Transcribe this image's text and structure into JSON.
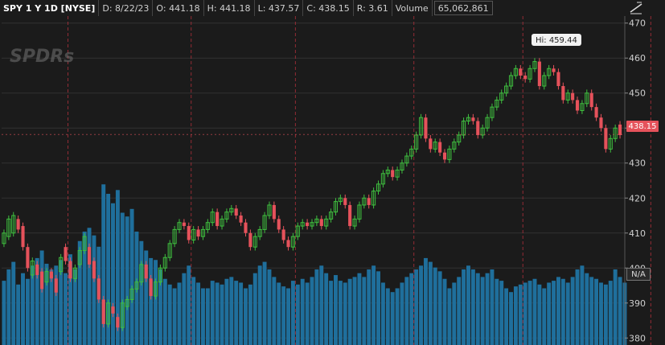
{
  "header": {
    "symbol": "SPY 1 Y 1D [NYSE]",
    "date": "D: 8/22/23",
    "open": "O: 441.18",
    "high": "H: 441.18",
    "low": "L: 437.57",
    "close": "C: 438.15",
    "range": "R: 3.61",
    "volume_label": "Volume",
    "volume_value": "65,062,861"
  },
  "watermark": "SPDRs",
  "hi_callout": "Hi: 459.44",
  "last_price_label": "438.15",
  "volume_badge": "N/A",
  "icons": {
    "draw": "drawing-tools-icon"
  },
  "colors": {
    "up": "#3fbf3f",
    "down": "#e5525b",
    "volume": "#1f6f9c",
    "grid": "#333333",
    "divider": "#b0303b",
    "background": "#1b1b1b"
  },
  "chart_data": {
    "type": "candlestick",
    "xlabel": "",
    "ylabel": "",
    "ylim": [
      378,
      472
    ],
    "yticks": [
      380,
      390,
      400,
      410,
      420,
      430,
      440,
      450,
      460,
      470
    ],
    "grid": true,
    "last_price": 438.15,
    "high": 459.44,
    "month_dividers_index": [
      14,
      40,
      62,
      87,
      110,
      137,
      162
    ],
    "candles": [
      [
        407,
        410
      ],
      [
        409,
        414
      ],
      [
        410,
        415
      ],
      [
        414,
        411
      ],
      [
        412,
        406
      ],
      [
        406,
        400
      ],
      [
        398,
        402
      ],
      [
        401,
        398
      ],
      [
        399,
        394
      ],
      [
        396,
        399
      ],
      [
        399,
        397
      ],
      [
        397,
        393
      ],
      [
        399,
        403
      ],
      [
        406,
        402
      ],
      [
        402,
        397
      ],
      [
        397,
        400
      ],
      [
        401,
        405
      ],
      [
        405,
        409
      ],
      [
        406,
        401
      ],
      [
        402,
        397
      ],
      [
        397,
        391
      ],
      [
        391,
        384
      ],
      [
        384,
        390
      ],
      [
        389,
        387
      ],
      [
        386,
        383
      ],
      [
        383,
        390
      ],
      [
        389,
        391
      ],
      [
        391,
        394
      ],
      [
        394,
        396
      ],
      [
        396,
        401
      ],
      [
        401,
        397
      ],
      [
        397,
        392
      ],
      [
        392,
        396
      ],
      [
        396,
        400
      ],
      [
        400,
        403
      ],
      [
        403,
        407
      ],
      [
        407,
        411
      ],
      [
        411,
        413
      ],
      [
        413,
        412
      ],
      [
        412,
        408
      ],
      [
        408,
        411
      ],
      [
        411,
        409
      ],
      [
        409,
        411
      ],
      [
        411,
        413
      ],
      [
        413,
        416
      ],
      [
        416,
        412
      ],
      [
        412,
        414
      ],
      [
        414,
        416
      ],
      [
        416,
        417
      ],
      [
        417,
        415
      ],
      [
        415,
        413
      ],
      [
        413,
        410
      ],
      [
        410,
        406
      ],
      [
        406,
        409
      ],
      [
        409,
        411
      ],
      [
        411,
        415
      ],
      [
        415,
        418
      ],
      [
        418,
        414
      ],
      [
        414,
        411
      ],
      [
        411,
        408
      ],
      [
        408,
        406
      ],
      [
        406,
        409
      ],
      [
        409,
        412
      ],
      [
        412,
        413
      ],
      [
        413,
        412
      ],
      [
        412,
        413
      ],
      [
        413,
        414
      ],
      [
        414,
        412
      ],
      [
        412,
        414
      ],
      [
        414,
        416
      ],
      [
        416,
        419
      ],
      [
        419,
        420
      ],
      [
        420,
        418
      ],
      [
        418,
        412
      ],
      [
        412,
        414
      ],
      [
        414,
        418
      ],
      [
        418,
        420
      ],
      [
        420,
        418
      ],
      [
        418,
        422
      ],
      [
        422,
        424
      ],
      [
        424,
        427
      ],
      [
        427,
        428
      ],
      [
        428,
        426
      ],
      [
        426,
        428
      ],
      [
        428,
        430
      ],
      [
        430,
        432
      ],
      [
        432,
        434
      ],
      [
        434,
        438
      ],
      [
        438,
        443
      ],
      [
        443,
        437
      ],
      [
        437,
        434
      ],
      [
        434,
        436
      ],
      [
        436,
        433
      ],
      [
        433,
        431
      ],
      [
        431,
        434
      ],
      [
        434,
        436
      ],
      [
        436,
        438
      ],
      [
        438,
        442
      ],
      [
        442,
        443
      ],
      [
        443,
        442
      ],
      [
        442,
        438
      ],
      [
        438,
        440
      ],
      [
        440,
        443
      ],
      [
        443,
        446
      ],
      [
        446,
        448
      ],
      [
        448,
        450
      ],
      [
        450,
        452
      ],
      [
        452,
        455
      ],
      [
        455,
        457
      ],
      [
        457,
        455
      ],
      [
        455,
        454
      ],
      [
        454,
        457
      ],
      [
        457,
        459
      ],
      [
        459,
        452
      ],
      [
        452,
        455
      ],
      [
        455,
        457
      ],
      [
        457,
        456
      ],
      [
        456,
        452
      ],
      [
        452,
        448
      ],
      [
        448,
        450
      ],
      [
        450,
        448
      ],
      [
        448,
        445
      ],
      [
        445,
        447
      ],
      [
        447,
        450
      ],
      [
        450,
        446
      ],
      [
        446,
        443
      ],
      [
        443,
        440
      ],
      [
        440,
        434
      ],
      [
        434,
        437
      ],
      [
        437,
        440
      ],
      [
        441,
        438
      ]
    ],
    "volumes": [
      0.34,
      0.4,
      0.44,
      0.32,
      0.38,
      0.35,
      0.42,
      0.46,
      0.5,
      0.43,
      0.4,
      0.42,
      0.45,
      0.38,
      0.48,
      0.4,
      0.55,
      0.6,
      0.62,
      0.58,
      0.52,
      0.85,
      0.8,
      0.75,
      0.82,
      0.7,
      0.68,
      0.72,
      0.6,
      0.55,
      0.5,
      0.46,
      0.45,
      0.4,
      0.35,
      0.32,
      0.3,
      0.33,
      0.38,
      0.42,
      0.36,
      0.33,
      0.3,
      0.3,
      0.34,
      0.33,
      0.32,
      0.35,
      0.36,
      0.34,
      0.33,
      0.3,
      0.32,
      0.38,
      0.42,
      0.44,
      0.4,
      0.36,
      0.33,
      0.31,
      0.3,
      0.34,
      0.32,
      0.35,
      0.33,
      0.36,
      0.4,
      0.42,
      0.38,
      0.34,
      0.37,
      0.34,
      0.33,
      0.35,
      0.36,
      0.38,
      0.36,
      0.4,
      0.42,
      0.39,
      0.33,
      0.3,
      0.28,
      0.3,
      0.33,
      0.36,
      0.38,
      0.4,
      0.42,
      0.46,
      0.44,
      0.41,
      0.39,
      0.35,
      0.3,
      0.33,
      0.36,
      0.4,
      0.42,
      0.4,
      0.38,
      0.36,
      0.38,
      0.4,
      0.35,
      0.34,
      0.3,
      0.28,
      0.31,
      0.32,
      0.33,
      0.34,
      0.35,
      0.32,
      0.3,
      0.33,
      0.34,
      0.36,
      0.35,
      0.33,
      0.36,
      0.4,
      0.42,
      0.38,
      0.36,
      0.35,
      0.33,
      0.32,
      0.34,
      0.4,
      0.36,
      0.33
    ]
  }
}
